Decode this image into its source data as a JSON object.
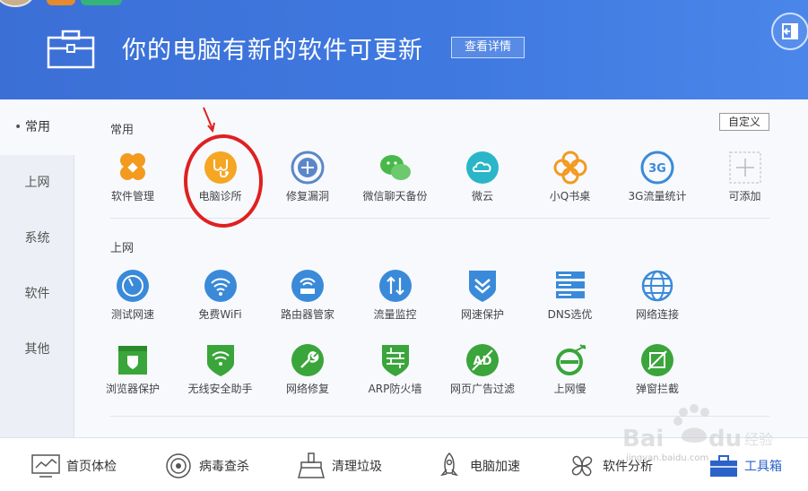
{
  "header": {
    "headline": "你的电脑有新的软件可更新",
    "detail_button": "查看详情"
  },
  "sidebar": {
    "items": [
      {
        "label": "常用"
      },
      {
        "label": "上网"
      },
      {
        "label": "系统"
      },
      {
        "label": "软件"
      },
      {
        "label": "其他"
      }
    ]
  },
  "main": {
    "customize_button": "自定义",
    "sections": [
      {
        "title": "常用"
      },
      {
        "title": "上网"
      }
    ],
    "common_tools": [
      {
        "label": "软件管理",
        "icon": "clover-icon",
        "color": "#f39a1f"
      },
      {
        "label": "电脑诊所",
        "icon": "stethoscope-icon",
        "color": "#f5a623"
      },
      {
        "label": "修复漏洞",
        "icon": "patch-icon",
        "color": "#5b87c8"
      },
      {
        "label": "微信聊天备份",
        "icon": "wechat-icon",
        "color": "#49b84a"
      },
      {
        "label": "微云",
        "icon": "cloud-icon",
        "color": "#2bb5c9"
      },
      {
        "label": "小Q书桌",
        "icon": "flower-icon",
        "color": "#f39a1f"
      },
      {
        "label": "3G流量统计",
        "icon": "3g-icon",
        "color": "#3a8ad9",
        "icon_text": "3G"
      },
      {
        "label": "可添加",
        "icon": "plus-icon",
        "color": "#bbbbbb"
      }
    ],
    "internet_tools_row1": [
      {
        "label": "测试网速",
        "icon": "speedometer-icon",
        "color": "#3a8ad9"
      },
      {
        "label": "免费WiFi",
        "icon": "wifi-icon",
        "color": "#3a8ad9"
      },
      {
        "label": "路由器管家",
        "icon": "router-icon",
        "color": "#3a8ad9"
      },
      {
        "label": "流量监控",
        "icon": "traffic-icon",
        "color": "#3a8ad9"
      },
      {
        "label": "网速保护",
        "icon": "shield-chevron-icon",
        "color": "#3a8ad9"
      },
      {
        "label": "DNS选优",
        "icon": "server-icon",
        "color": "#3a8ad9"
      },
      {
        "label": "网络连接",
        "icon": "globe-icon",
        "color": "#3a8ad9"
      }
    ],
    "internet_tools_row2": [
      {
        "label": "浏览器保护",
        "icon": "browser-shield-icon",
        "color": "#3aa53a"
      },
      {
        "label": "无线安全助手",
        "icon": "wifi-shield-icon",
        "color": "#3aa53a"
      },
      {
        "label": "网络修复",
        "icon": "wrench-icon",
        "color": "#3aa53a"
      },
      {
        "label": "ARP防火墙",
        "icon": "firewall-icon",
        "color": "#3aa53a"
      },
      {
        "label": "网页广告过滤",
        "icon": "ad-block-icon",
        "color": "#3aa53a",
        "icon_text": "AD"
      },
      {
        "label": "上网慢",
        "icon": "ie-icon",
        "color": "#3aa53a"
      },
      {
        "label": "弹窗拦截",
        "icon": "popup-block-icon",
        "color": "#3aa53a"
      }
    ]
  },
  "bottom_nav": [
    {
      "label": "首页体检",
      "icon": "monitor-chart-icon"
    },
    {
      "label": "病毒查杀",
      "icon": "target-icon"
    },
    {
      "label": "清理垃圾",
      "icon": "broom-icon"
    },
    {
      "label": "电脑加速",
      "icon": "rocket-icon"
    },
    {
      "label": "软件分析",
      "icon": "pinwheel-icon"
    },
    {
      "label": "工具箱",
      "icon": "toolbox-icon"
    }
  ],
  "watermark": {
    "brand": "Baidu经验",
    "url": "jingyan.baidu.com"
  },
  "colors": {
    "header_blue": "#3b6fd6",
    "accent": "#2a62c9",
    "annotation_red": "#e02020"
  }
}
